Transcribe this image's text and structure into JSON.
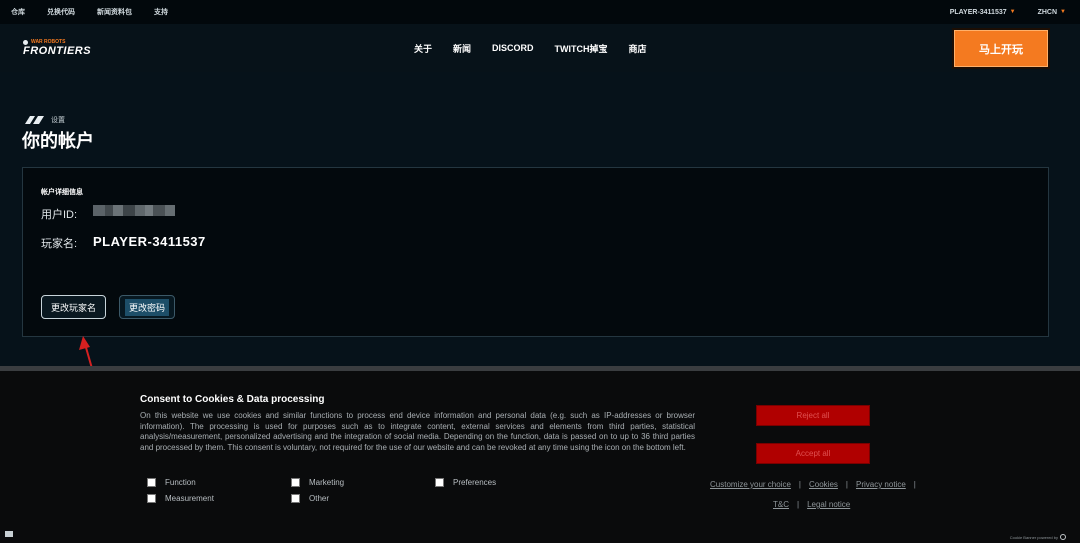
{
  "topbar": {
    "links": [
      "仓库",
      "兑换代码",
      "新闻资料包",
      "支持"
    ],
    "player": "PLAYER-3411537",
    "language": "ZHCN"
  },
  "nav": {
    "logo_small": "WAR ROBOTS",
    "logo_big": "FRONTIERS",
    "menu": [
      "关于",
      "新闻",
      "DISCORD",
      "TWITCH掉宝",
      "商店"
    ],
    "play_label": "马上开玩"
  },
  "page": {
    "breadcrumb": "设置",
    "title": "你的帐户"
  },
  "account": {
    "heading": "帐户详细信息",
    "user_id_label": "用户ID:",
    "player_name_label": "玩家名:",
    "player_name": "PLAYER-3411537",
    "change_name_label": "更改玩家名",
    "change_password_label": "更改密码"
  },
  "cookie": {
    "title": "Consent to Cookies & Data processing",
    "body": "On this website we use cookies and similar functions to process end device information and personal data (e.g. such as IP-addresses or browser information). The processing is used for purposes such as to integrate content, external services and elements from third parties, statistical analysis/measurement, personalized advertising and the integration of social media. Depending on the function, data is passed on to up to 36 third parties and processed by them. This consent is voluntary, not required for the use of our website and can be revoked at any time using the icon on the bottom left.",
    "checkboxes": [
      "Function",
      "Marketing",
      "Preferences",
      "Measurement",
      "Other"
    ],
    "reject_label": "Reject all",
    "accept_label": "Accept all",
    "links": [
      "Customize your choice",
      "Cookies",
      "Privacy notice",
      "T&C",
      "Legal notice"
    ],
    "powered": "Cookie Banner powered by"
  },
  "colors": {
    "accent": "#f47a20",
    "background": "#06121a",
    "reject": "#b00000",
    "annotation_arrow": "#d42020"
  }
}
